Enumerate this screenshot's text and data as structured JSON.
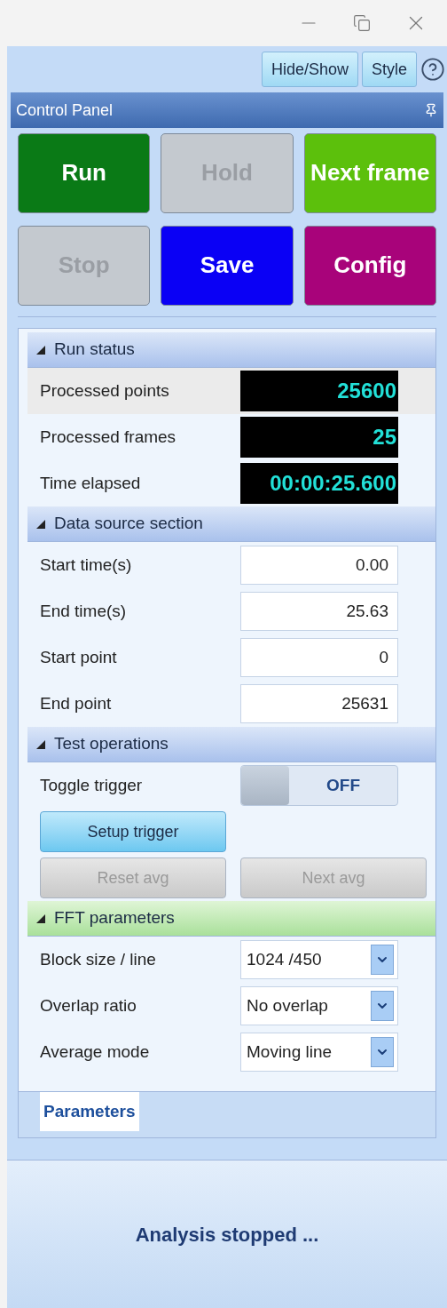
{
  "toolbar": {
    "buttons": [
      "Hide/Show",
      "Style"
    ]
  },
  "panel": {
    "title": "Control Panel"
  },
  "action_buttons": [
    {
      "label": "Run",
      "disabled": false,
      "color": "#0a7a16"
    },
    {
      "label": "Hold",
      "disabled": true,
      "color": "#c4c9cf"
    },
    {
      "label": "Next frame",
      "disabled": false,
      "color": "#5cc00c"
    },
    {
      "label": "Stop",
      "disabled": true,
      "color": "#c4c9cf"
    },
    {
      "label": "Save",
      "disabled": false,
      "color": "#0a00f5"
    },
    {
      "label": "Config",
      "disabled": false,
      "color": "#a8037a"
    }
  ],
  "sections": [
    {
      "title": "Run status",
      "expanded": true,
      "selected": false,
      "rows": [
        {
          "kind": "readout",
          "label": "Processed points",
          "value": "25600",
          "selected": true
        },
        {
          "kind": "readout",
          "label": "Processed frames",
          "value": "25",
          "selected": false
        },
        {
          "kind": "readout",
          "label": "Time elapsed",
          "value": "00:00:25.600",
          "selected": false
        }
      ]
    },
    {
      "title": "Data source section",
      "expanded": true,
      "selected": false,
      "rows": [
        {
          "kind": "input",
          "label": "Start time(s)",
          "value": "0.00",
          "selected": false
        },
        {
          "kind": "input",
          "label": "End time(s)",
          "value": "25.63",
          "selected": false
        },
        {
          "kind": "input",
          "label": "Start point",
          "value": "0",
          "selected": false
        },
        {
          "kind": "input",
          "label": "End point",
          "value": "25631",
          "selected": false
        }
      ]
    },
    {
      "title": "Test operations",
      "expanded": true,
      "selected": false,
      "rows": [
        {
          "kind": "toggle",
          "label": "Toggle trigger",
          "on": false,
          "value": "OFF",
          "selected": false
        },
        {
          "kind": "buttons",
          "buttons": [
            {
              "label": "Setup trigger",
              "disabled": false,
              "highlighted": true
            }
          ]
        },
        {
          "kind": "buttons",
          "buttons": [
            {
              "label": "Reset avg",
              "disabled": true,
              "highlighted": false
            },
            {
              "label": "Next avg",
              "disabled": true,
              "highlighted": false
            }
          ]
        }
      ]
    },
    {
      "title": "FFT parameters",
      "expanded": true,
      "selected": true,
      "rows": [
        {
          "kind": "dropdown",
          "label": "Block size / line",
          "value": "1024 /450",
          "selected": false
        },
        {
          "kind": "dropdown",
          "label": "Overlap ratio",
          "value": "No overlap",
          "selected": false
        },
        {
          "kind": "dropdown",
          "label": "Average mode",
          "value": "Moving line",
          "selected": false
        }
      ]
    }
  ],
  "tabs": [
    {
      "label": "Parameters",
      "selected": true
    }
  ],
  "status": "Analysis stopped ..."
}
